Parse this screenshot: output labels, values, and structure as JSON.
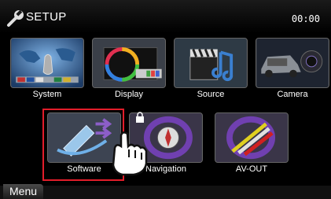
{
  "header": {
    "title": "SETUP",
    "clock": "00:00"
  },
  "tiles": [
    {
      "label": "System"
    },
    {
      "label": "Display"
    },
    {
      "label": "Source"
    },
    {
      "label": "Camera"
    },
    {
      "label": "Software"
    },
    {
      "label": "Navigation"
    },
    {
      "label": "AV-OUT"
    }
  ],
  "footer": {
    "menu_label": "Menu"
  },
  "colors": {
    "highlight": "#e21d2a",
    "background": "#000000"
  }
}
